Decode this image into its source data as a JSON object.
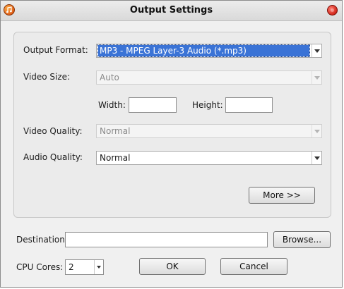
{
  "window": {
    "title": "Output Settings"
  },
  "icons": {
    "app": "app-music-icon",
    "close": "close-icon"
  },
  "settings": {
    "output_format": {
      "label": "Output Format:",
      "value": "MP3 - MPEG Layer-3 Audio (*.mp3)"
    },
    "video_size": {
      "label": "Video Size:",
      "value": "Auto"
    },
    "width": {
      "label": "Width:",
      "value": ""
    },
    "height": {
      "label": "Height:",
      "value": ""
    },
    "video_quality": {
      "label": "Video Quality:",
      "value": "Normal"
    },
    "audio_quality": {
      "label": "Audio Quality:",
      "value": "Normal"
    },
    "more_button": "More >>"
  },
  "footer": {
    "destination": {
      "label": "Destination:",
      "value": ""
    },
    "browse_button": "Browse...",
    "cpu_cores": {
      "label": "CPU Cores:",
      "value": "2"
    },
    "ok_button": "OK",
    "cancel_button": "Cancel"
  },
  "colors": {
    "selection": "#3a73d6",
    "close_button": "#d1271b",
    "app_icon": "#e0601a"
  }
}
